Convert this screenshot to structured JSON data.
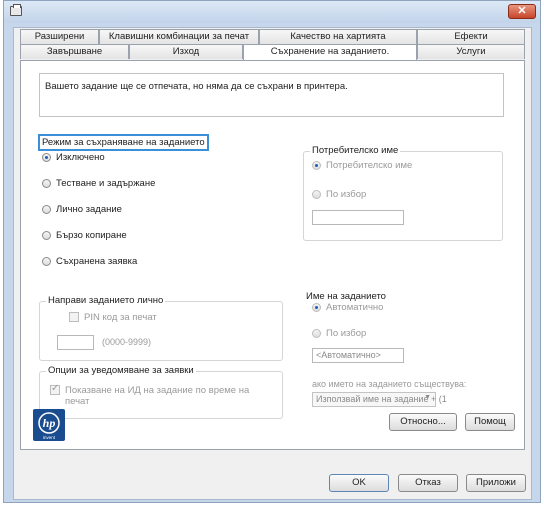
{
  "window": {
    "close_label": "✕"
  },
  "tabs": {
    "row_back": [
      {
        "label": "Разширени"
      },
      {
        "label": "Клавишни комбинации за печат"
      },
      {
        "label": "Качество на хартията"
      },
      {
        "label": "Ефекти"
      }
    ],
    "row_front": [
      {
        "label": "Завършване"
      },
      {
        "label": "Изход"
      },
      {
        "label": "Съхранение на заданието."
      },
      {
        "label": "Услуги"
      }
    ],
    "active": "Съхранение на заданието."
  },
  "message": "Вашето задание ще се отпечата, но няма да се съхрани в принтера.",
  "storage_mode": {
    "legend": "Режим за съхраняване на заданието",
    "options": [
      {
        "label": "Изключено",
        "selected": true
      },
      {
        "label": "Тестване и задържане",
        "selected": false
      },
      {
        "label": "Лично задание",
        "selected": false
      },
      {
        "label": "Бързо копиране",
        "selected": false
      },
      {
        "label": "Съхранена заявка",
        "selected": false
      }
    ]
  },
  "make_private": {
    "legend": "Направи заданието лично",
    "pin_label": "PIN код за печат",
    "pin_range": "(0000-9999)"
  },
  "notify": {
    "legend": "Опции за уведомяване за заявки",
    "show_id_label": "Показване на ИД на задание по време на печат"
  },
  "user_name": {
    "legend": "Потребителско име",
    "opt_user": "Потребителско име",
    "opt_custom": "По избор",
    "value": ""
  },
  "job_name": {
    "legend": "Име на заданието",
    "opt_auto": "Автоматично",
    "opt_custom": "По избор",
    "value": "<Автоматично>",
    "exists_label": "ако името на заданието съществува:",
    "exists_select": "Използвай име на задание + (1"
  },
  "logo": {
    "text": "invent",
    "icon": "hp-logo"
  },
  "buttons": {
    "about": "Относно...",
    "help": "Помощ",
    "ok": "OK",
    "cancel": "Отказ",
    "apply": "Приложи"
  },
  "colors": {
    "highlight": "#3a8fd8",
    "title_bg": "#c6d7ec",
    "close": "#c8452a",
    "hp_blue": "#1a4d8f"
  }
}
